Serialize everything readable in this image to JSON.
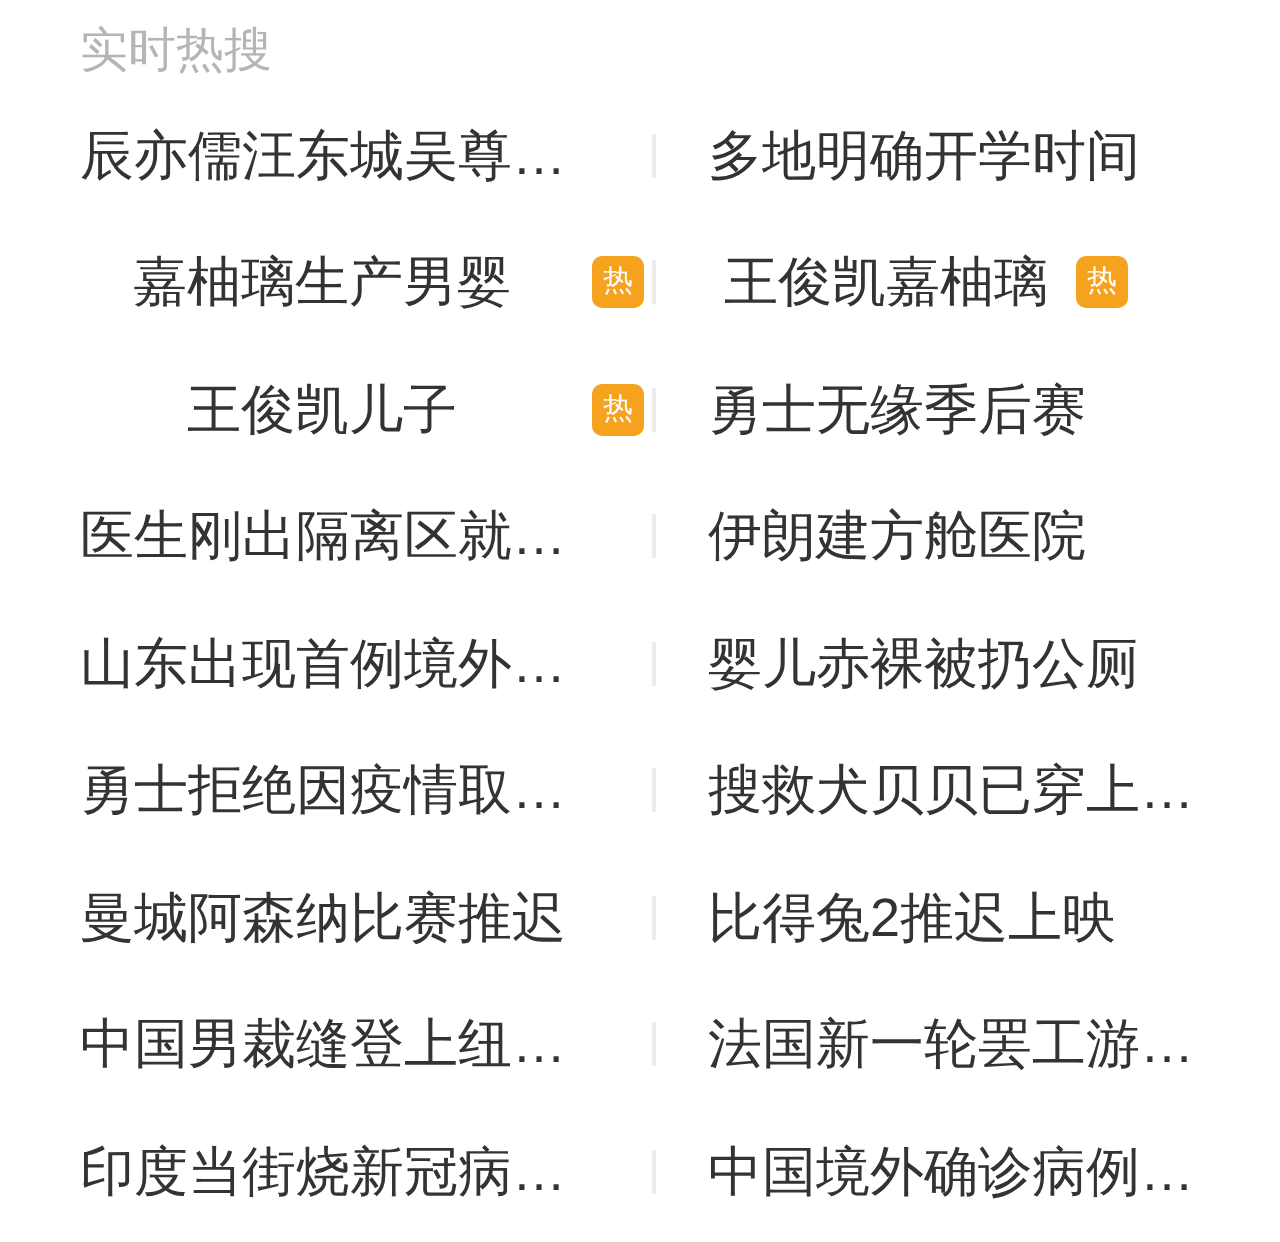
{
  "title": "实时热搜",
  "rows": [
    [
      {
        "text": "辰亦儒汪东城吴尊…"
      },
      {
        "text": "多地明确开学时间"
      }
    ],
    [
      {
        "text": "嘉柚璃生产男婴",
        "badge": "热"
      },
      {
        "text": "王俊凯嘉柚璃",
        "badge": "热"
      }
    ],
    [
      {
        "text": "王俊凯儿子",
        "badge": "热"
      },
      {
        "text": "勇士无缘季后赛"
      }
    ],
    [
      {
        "text": "医生刚出隔离区就…"
      },
      {
        "text": "伊朗建方舱医院"
      }
    ],
    [
      {
        "text": "山东出现首例境外…"
      },
      {
        "text": "婴儿赤裸被扔公厕"
      }
    ],
    [
      {
        "text": "勇士拒绝因疫情取…"
      },
      {
        "text": "搜救犬贝贝已穿上…"
      }
    ],
    [
      {
        "text": "曼城阿森纳比赛推迟"
      },
      {
        "text": "比得兔2推迟上映"
      }
    ],
    [
      {
        "text": "中国男裁缝登上纽…"
      },
      {
        "text": "法国新一轮罢工游…"
      }
    ],
    [
      {
        "text": "印度当街烧新冠病…"
      },
      {
        "text": "中国境外确诊病例…"
      }
    ]
  ]
}
